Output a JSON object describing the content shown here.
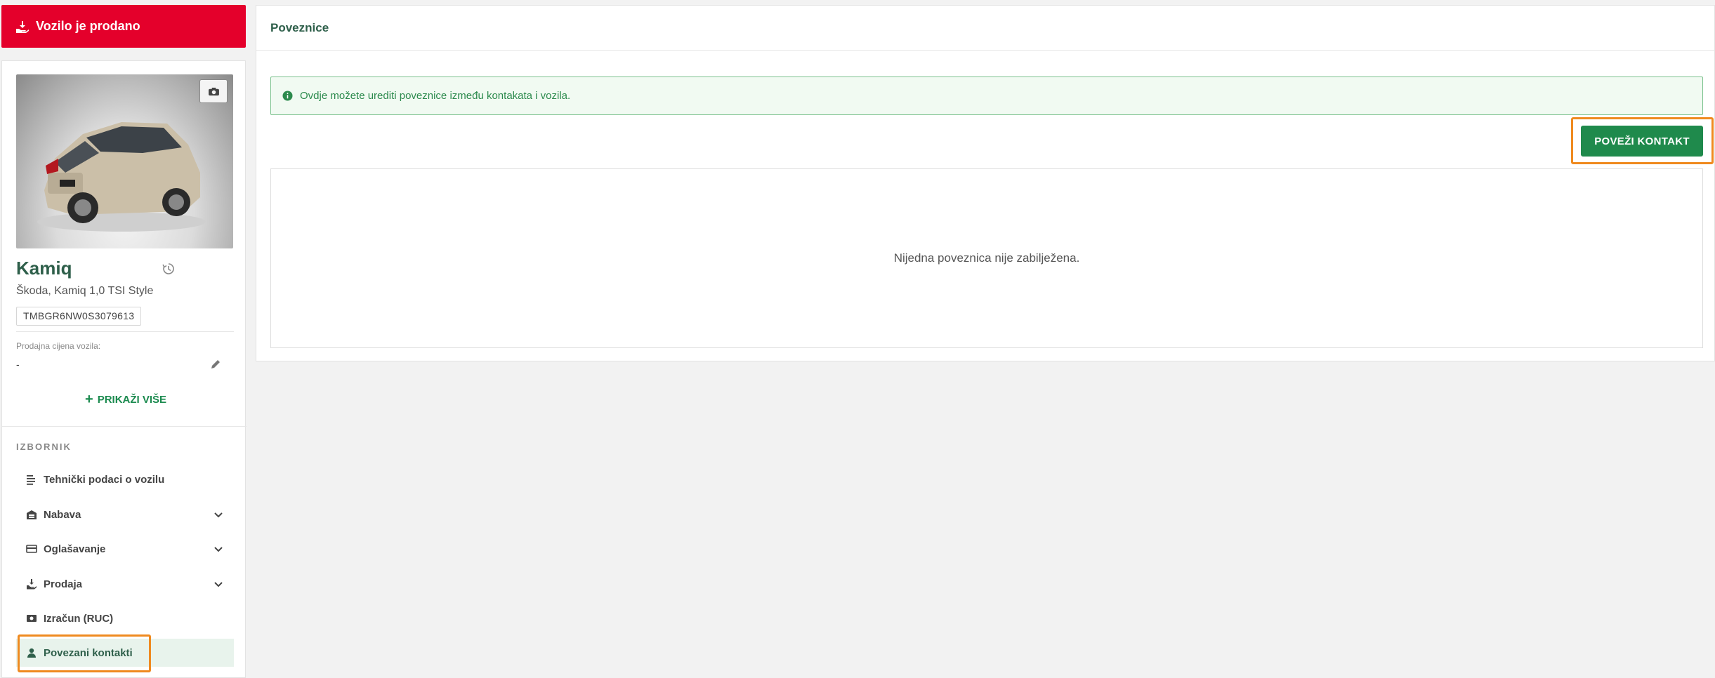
{
  "banner": {
    "label": "Vozilo je prodano",
    "icon": "hand-sold-icon",
    "color": "#e4002b"
  },
  "vehicle": {
    "name": "Kamiq",
    "model": "Škoda, Kamiq 1,0 TSI Style",
    "vin": "TMBGR6NW0S3079613",
    "price_label": "Prodajna cijena vozila:",
    "price_value": "-",
    "show_more": "PRIKAŽI VIŠE"
  },
  "menu": {
    "heading": "IZBORNIK",
    "items": [
      {
        "label": "Tehnički podaci o vozilu",
        "icon": "list-icon",
        "expandable": false
      },
      {
        "label": "Nabava",
        "icon": "warehouse-icon",
        "expandable": true
      },
      {
        "label": "Oglašavanje",
        "icon": "card-icon",
        "expandable": true
      },
      {
        "label": "Prodaja",
        "icon": "hand-sold-icon",
        "expandable": true
      },
      {
        "label": "Izračun (RUC)",
        "icon": "cash-icon",
        "expandable": false
      },
      {
        "label": "Povezani kontakti",
        "icon": "person-icon",
        "expandable": false,
        "active": true
      }
    ]
  },
  "main": {
    "title": "Poveznice",
    "info": "Ovdje možete urediti poveznice između kontakata i vozila.",
    "connect_button": "POVEŽI KONTAKT",
    "empty_text": "Nijedna poveznica nije zabilježena."
  },
  "colors": {
    "accent": "#1f8a4c",
    "heading_green": "#2e5f4a",
    "highlight": "#ef8a1f"
  }
}
